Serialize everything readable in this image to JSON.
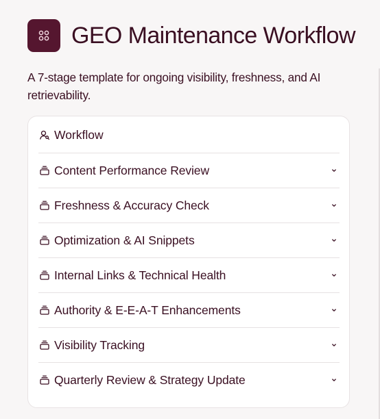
{
  "header": {
    "title": "GEO Maintenance Workflow",
    "icon": "grid-cluster-icon"
  },
  "description": "A 7-stage template for ongoing visibility, freshness, and AI retrievability.",
  "workflow": {
    "label": "Workflow",
    "icon": "user-search-icon"
  },
  "stages": [
    {
      "label": "Content Performance Review",
      "icon": "stack-icon",
      "expand_icon": "chevron-down-icon"
    },
    {
      "label": "Freshness & Accuracy Check",
      "icon": "stack-icon",
      "expand_icon": "chevron-down-icon"
    },
    {
      "label": "Optimization & AI Snippets",
      "icon": "stack-icon",
      "expand_icon": "chevron-down-icon"
    },
    {
      "label": "Internal Links & Technical Health",
      "icon": "stack-icon",
      "expand_icon": "chevron-down-icon"
    },
    {
      "label": "Authority & E-E-A-T Enhancements",
      "icon": "stack-icon",
      "expand_icon": "chevron-down-icon"
    },
    {
      "label": "Visibility Tracking",
      "icon": "stack-icon",
      "expand_icon": "chevron-down-icon"
    },
    {
      "label": "Quarterly Review & Strategy Update",
      "icon": "stack-icon",
      "expand_icon": "chevron-down-icon"
    }
  ],
  "colors": {
    "brand": "#55162f",
    "text": "#3a0f22",
    "background": "#f8f6f6",
    "panel": "#ffffff",
    "divider": "#e6e1e2"
  }
}
